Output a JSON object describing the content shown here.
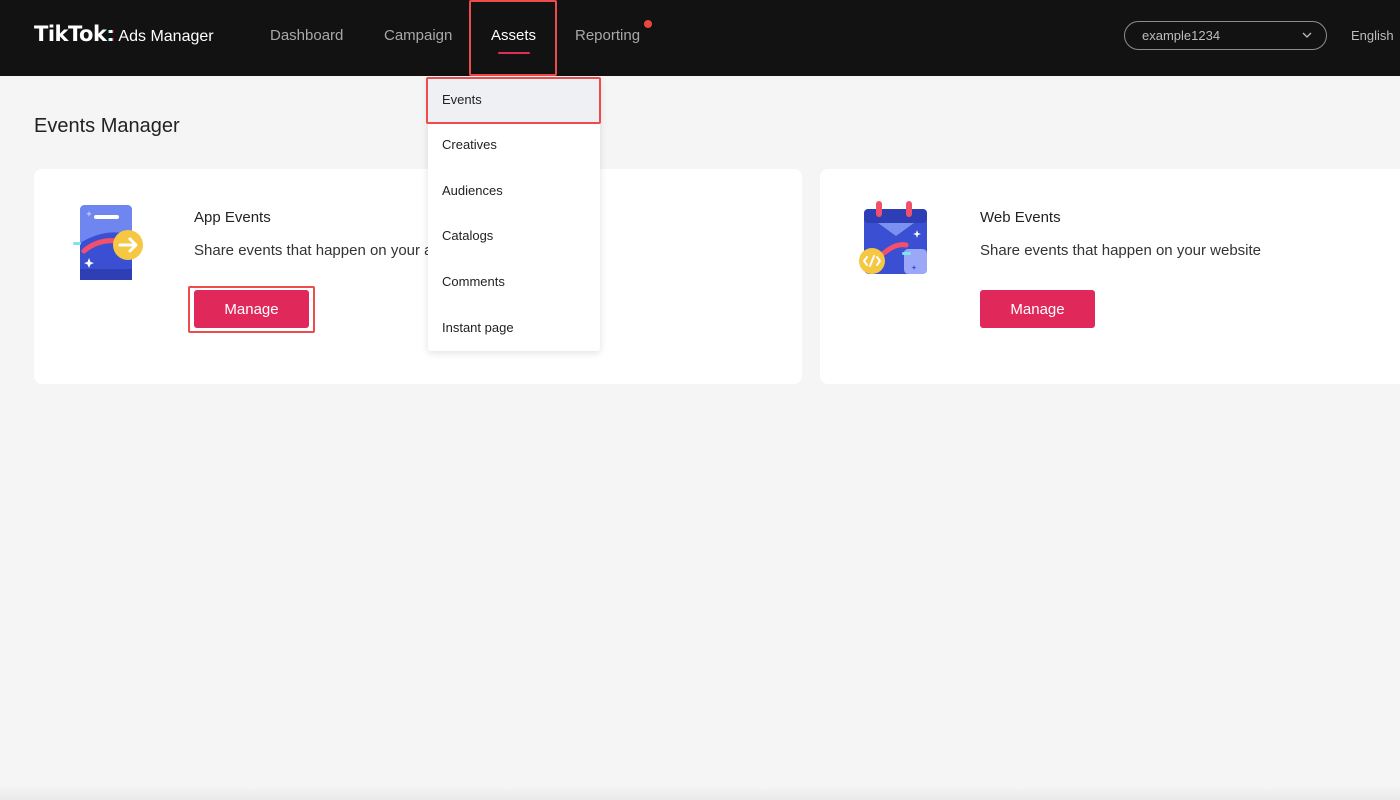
{
  "header": {
    "logo_brand": "TikTok",
    "logo_colon": ":",
    "logo_product": "Ads Manager",
    "nav": [
      {
        "label": "Dashboard",
        "active": false
      },
      {
        "label": "Campaign",
        "active": false
      },
      {
        "label": "Assets",
        "active": true
      },
      {
        "label": "Reporting",
        "active": false,
        "has_notification": true
      }
    ],
    "account": {
      "value": "example1234",
      "icon": "chevron-down-icon"
    },
    "language": "English"
  },
  "assets_menu": {
    "items": [
      {
        "label": "Events",
        "selected": true
      },
      {
        "label": "Creatives",
        "selected": false
      },
      {
        "label": "Audiences",
        "selected": false
      },
      {
        "label": "Catalogs",
        "selected": false
      },
      {
        "label": "Comments",
        "selected": false
      },
      {
        "label": "Instant page",
        "selected": false
      }
    ]
  },
  "page": {
    "title": "Events Manager",
    "cards": [
      {
        "title": "App Events",
        "description": "Share events that happen on your app",
        "button_label": "Manage",
        "icon": "mobile-app-events-icon"
      },
      {
        "title": "Web Events",
        "description": "Share events that happen on your website",
        "button_label": "Manage",
        "icon": "web-events-calendar-icon"
      }
    ]
  },
  "colors": {
    "topbar_bg": "#121212",
    "accent": "#e0295a",
    "highlight_border": "#ec4c4c",
    "notification_dot": "#e8483b",
    "page_bg": "#f5f5f5"
  }
}
